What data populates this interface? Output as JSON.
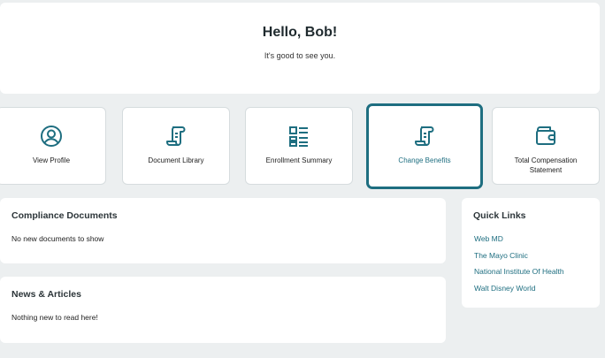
{
  "hero": {
    "greeting": "Hello, Bob!",
    "subtitle": "It's good to see you."
  },
  "tiles": [
    {
      "label": "View Profile",
      "icon": "user-circle-icon"
    },
    {
      "label": "Document Library",
      "icon": "scroll-icon"
    },
    {
      "label": "Enrollment Summary",
      "icon": "list-icon"
    },
    {
      "label": "Change Benefits",
      "icon": "scroll-icon",
      "active": true
    },
    {
      "label": "Total Compensation Statement",
      "icon": "wallet-icon"
    }
  ],
  "compliance": {
    "title": "Compliance Documents",
    "message": "No new documents to show"
  },
  "news": {
    "title": "News & Articles",
    "message": "Nothing new to read here!"
  },
  "quick_links": {
    "title": "Quick Links",
    "items": [
      "Web MD",
      "The Mayo Clinic",
      "National Institute Of Health",
      "Walt Disney World"
    ]
  },
  "colors": {
    "accent": "#1e6e80",
    "background": "#eceff0",
    "card": "#ffffff"
  }
}
